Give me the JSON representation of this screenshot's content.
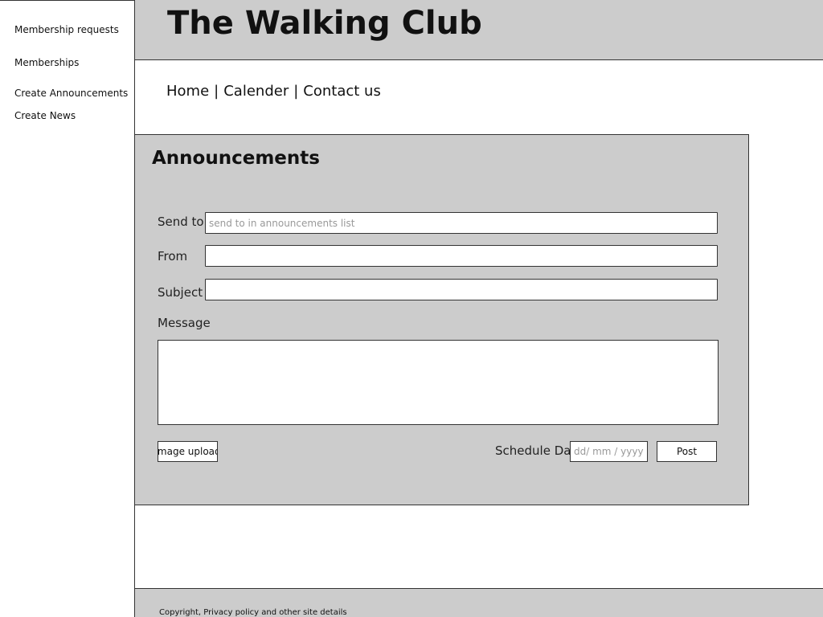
{
  "sidebar": {
    "items": [
      {
        "label": "Membership requests"
      },
      {
        "label": "Memberships"
      },
      {
        "label": "Create Announcements"
      },
      {
        "label": "Create News"
      }
    ]
  },
  "header": {
    "title": "The Walking Club"
  },
  "nav": {
    "items": [
      {
        "label": "Home"
      },
      {
        "label": "Calender"
      },
      {
        "label": "Contact us"
      }
    ],
    "separator": "|"
  },
  "announcements": {
    "title": "Announcements",
    "send_to": {
      "label": "Send to",
      "value": "",
      "placeholder": "send to in announcements list"
    },
    "from": {
      "label": "From",
      "value": ""
    },
    "subject": {
      "label": "Subject",
      "value": ""
    },
    "message": {
      "label": "Message",
      "value": ""
    },
    "image_upload_label": "Image upload",
    "schedule_date": {
      "label": "Schedule Dat",
      "placeholder": "dd/ mm / yyyy"
    },
    "post_label": "Post"
  },
  "footer": {
    "text": "Copyright, Privacy policy and other site details"
  },
  "colors": {
    "panel_bg": "#cccccc",
    "border": "#333333",
    "page_bg": "#ffffff"
  }
}
